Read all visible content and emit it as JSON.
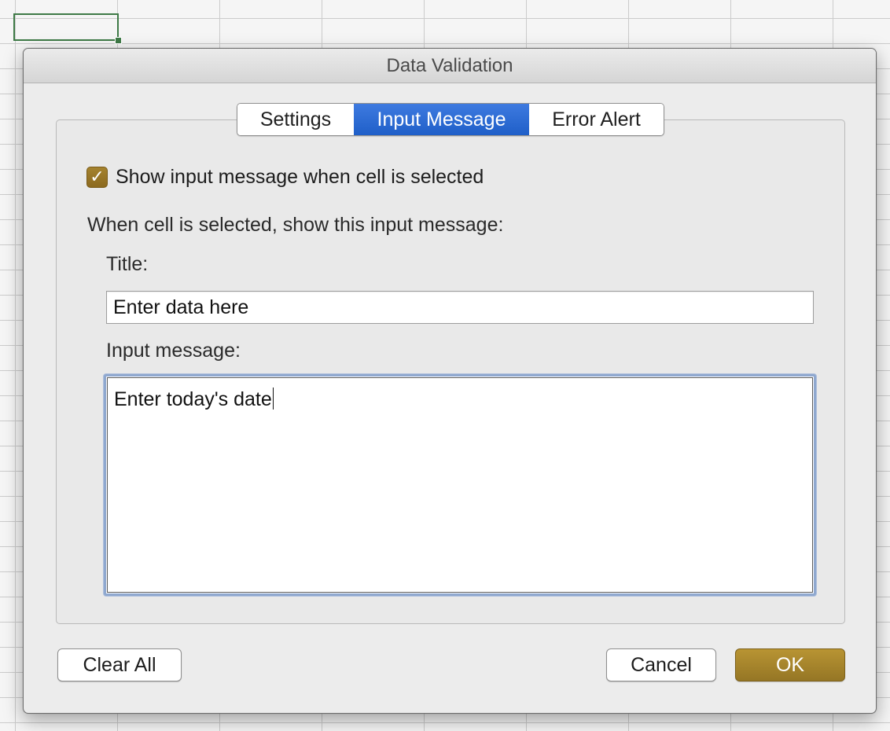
{
  "dialog": {
    "title": "Data Validation",
    "tabs": [
      {
        "label": "Settings",
        "active": false
      },
      {
        "label": "Input Message",
        "active": true
      },
      {
        "label": "Error Alert",
        "active": false
      }
    ],
    "show_input_checkbox": {
      "label": "Show input message when cell is selected",
      "checked": true
    },
    "instruction": "When cell is selected, show this input message:",
    "title_field": {
      "label": "Title:",
      "value": "Enter data here"
    },
    "message_field": {
      "label": "Input message:",
      "value": "Enter today's date"
    },
    "buttons": {
      "clear_all": "Clear All",
      "cancel": "Cancel",
      "ok": "OK"
    }
  },
  "colors": {
    "accent_tab": "#2a6ad6",
    "checkbox_gold": "#9a7826",
    "ok_button": "#a5852c",
    "active_cell_border": "#3e7a46"
  }
}
